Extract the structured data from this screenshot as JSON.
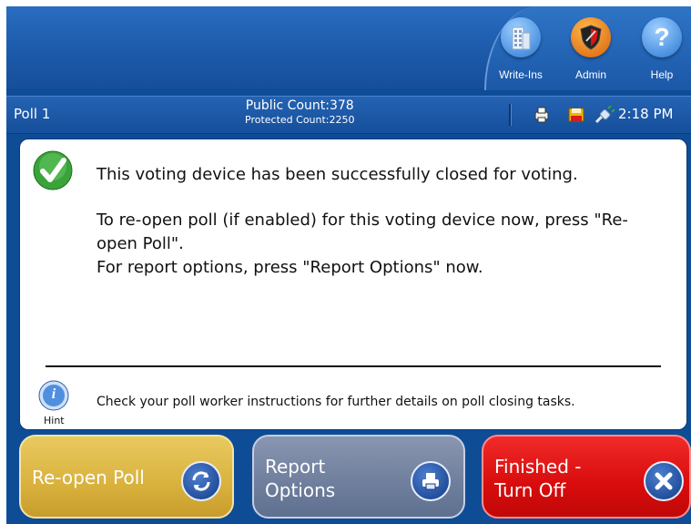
{
  "toolbar": {
    "writeins_label": "Write-Ins",
    "admin_label": "Admin",
    "help_label": "Help",
    "help_glyph": "?"
  },
  "status": {
    "poll_name": "Poll 1",
    "public_count": "Public Count:378",
    "protected_count": "Protected Count:2250",
    "time": "2:18 PM"
  },
  "message": {
    "closed_text": "This voting device has been successfully closed for voting.",
    "reopen_text": "To re-open poll (if enabled) for this voting device now, press \"Re-open Poll\".",
    "report_text": "For report options, press \"Report Options\" now."
  },
  "hint": {
    "label": "Hint",
    "glyph": "i",
    "text": "Check your poll worker instructions for further details on poll closing tasks."
  },
  "buttons": {
    "reopen_label": "Re-open Poll",
    "report_label_1": "Report",
    "report_label_2": "Options",
    "finish_label_1": "Finished -",
    "finish_label_2": "Turn Off"
  },
  "colors": {
    "background_blue": "#0f4c96",
    "reopen_gold": "#d9b23d",
    "report_slate": "#6e7e9c",
    "finish_red": "#d80c0c",
    "success_green": "#3aa43a"
  },
  "icons": {
    "writeins": "building-icon",
    "admin": "shield-icon",
    "help": "help-icon",
    "hint": "info-icon",
    "success": "checkmark-icon",
    "reopen": "refresh-icon",
    "report": "printer-icon",
    "finish": "close-icon"
  }
}
